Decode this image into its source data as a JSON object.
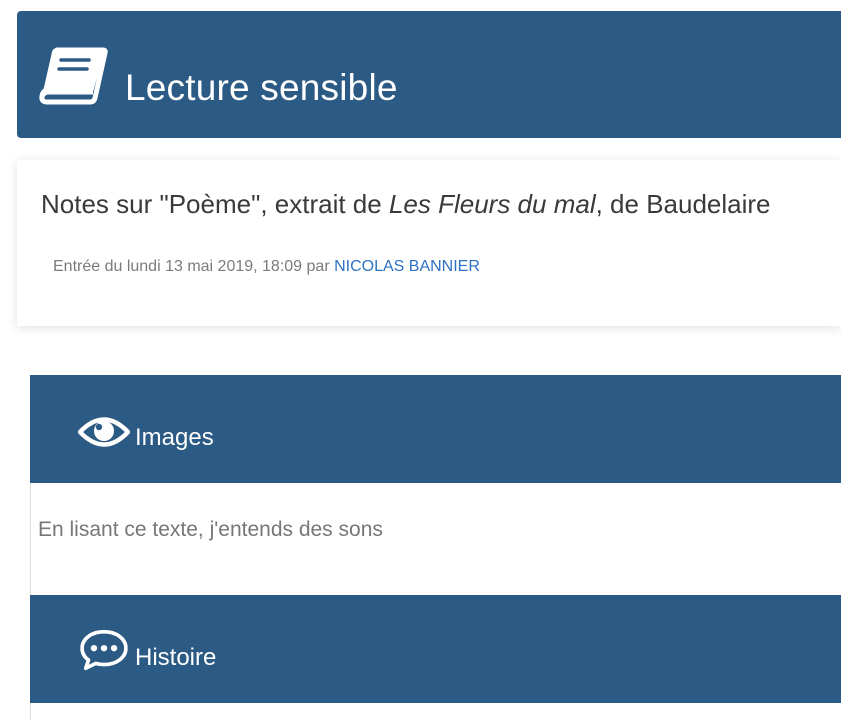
{
  "header": {
    "title": "Lecture sensible",
    "icon": "book-icon",
    "background": "#2b5a84"
  },
  "note": {
    "title_prefix": "Notes sur \"Poème\", extrait de ",
    "title_work": "Les Fleurs du mal",
    "title_suffix": ", de Baudelaire",
    "meta_prefix": "Entrée du lundi 13 mai 2019, 18:09 par ",
    "author": "NICOLAS BANNIER",
    "author_color": "#2f72c4"
  },
  "sections": [
    {
      "icon": "eye-icon",
      "label": "Images",
      "body": "En lisant ce texte, j'entends des sons"
    },
    {
      "icon": "speech-bubble-icon",
      "label": "Histoire",
      "body": ""
    }
  ]
}
